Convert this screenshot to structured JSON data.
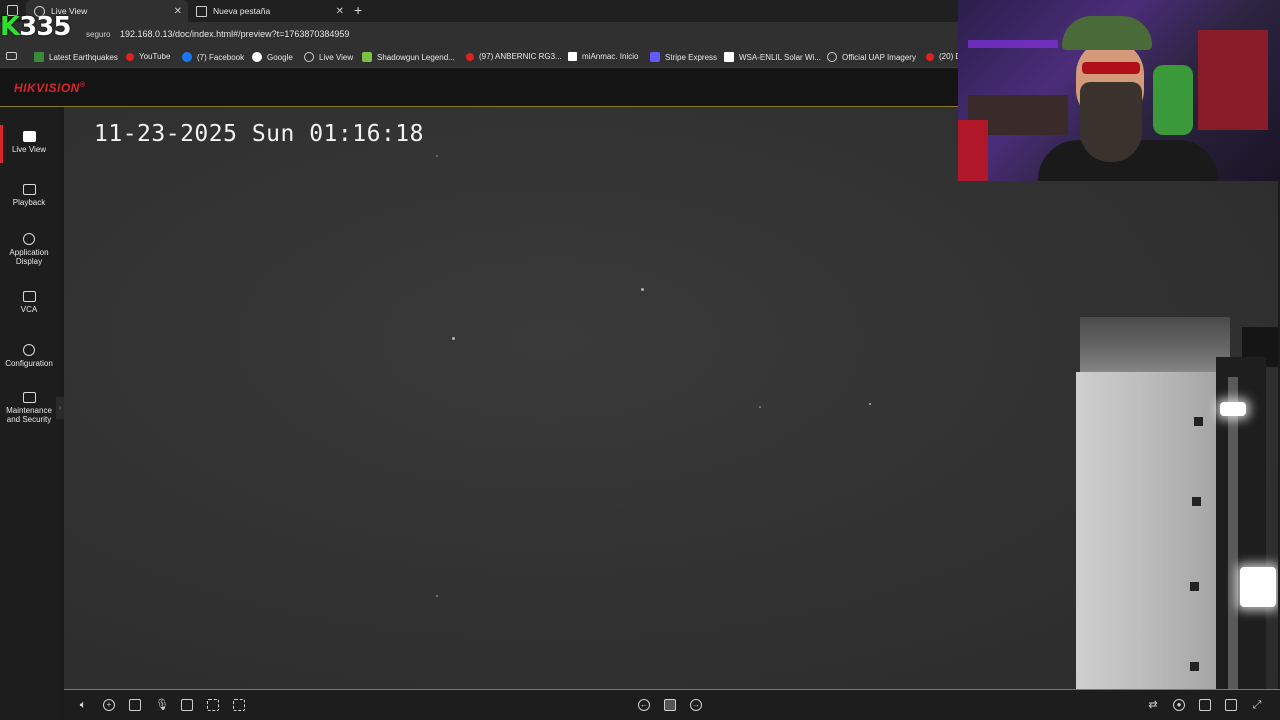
{
  "browser": {
    "tabs": [
      {
        "label": "Live View",
        "active": true
      },
      {
        "label": "Nueva pestaña",
        "active": false
      }
    ],
    "url_security": "seguro",
    "url": "192.168.0.13/doc/index.html#/preview?t=1763870384959",
    "bookmarks": [
      {
        "label": "Latest Earthquakes",
        "icon": "earthquake-icon",
        "color": "#3a8a3a"
      },
      {
        "label": "YouTube",
        "icon": "youtube-icon",
        "color": "#e02020"
      },
      {
        "label": "(7) Facebook",
        "icon": "facebook-icon",
        "color": "#1877f2"
      },
      {
        "label": "Google",
        "icon": "google-icon",
        "color": "#ffffff"
      },
      {
        "label": "Live View",
        "icon": "globe-icon",
        "color": "#cccccc"
      },
      {
        "label": "Shadowgun Legend...",
        "icon": "android-icon",
        "color": "#7ac143"
      },
      {
        "label": "(97) ANBERNIC RG3...",
        "icon": "youtube-icon",
        "color": "#e02020"
      },
      {
        "label": "miAnmac. Inicio",
        "icon": "r-icon",
        "color": "#ffffff"
      },
      {
        "label": "Stripe Express",
        "icon": "stripe-icon",
        "color": "#635bff"
      },
      {
        "label": "WSA-ENLIL Solar Wi...",
        "icon": "noaa-icon",
        "color": "#ffffff"
      },
      {
        "label": "Official UAP Imagery",
        "icon": "globe-icon",
        "color": "#cccccc"
      },
      {
        "label": "(20) D",
        "icon": "youtube-icon",
        "color": "#e02020"
      }
    ]
  },
  "overlay": {
    "prefix": "K",
    "number": "335"
  },
  "app": {
    "logo": "HIKVISION",
    "logo_mark": "®",
    "accent": "#d8252c"
  },
  "sidebar": {
    "items": [
      {
        "label": "Live View",
        "icon": "live-view-icon",
        "active": true
      },
      {
        "label": "Playback",
        "icon": "playback-icon",
        "active": false
      },
      {
        "label": "Application Display",
        "icon": "application-icon",
        "active": false
      },
      {
        "label": "VCA",
        "icon": "vca-icon",
        "active": false
      },
      {
        "label": "Configuration",
        "icon": "gear-icon",
        "active": false
      },
      {
        "label": "Maintenance and Security",
        "icon": "maintenance-icon",
        "active": false
      }
    ]
  },
  "video": {
    "timestamp": "11-23-2025 Sun 01:16:18"
  },
  "toolbar": {
    "left_icons": [
      "mute-icon",
      "zoom-icon",
      "camera-icon",
      "microphone-icon",
      "snapshot-icon",
      "focus-icon",
      "fullscreen-region-icon"
    ],
    "center_icons": [
      "previous-icon",
      "stop-icon",
      "next-icon"
    ],
    "right_icons": [
      "stream-icon",
      "record-icon",
      "layout-icon",
      "window-icon",
      "fullscreen-icon"
    ]
  }
}
